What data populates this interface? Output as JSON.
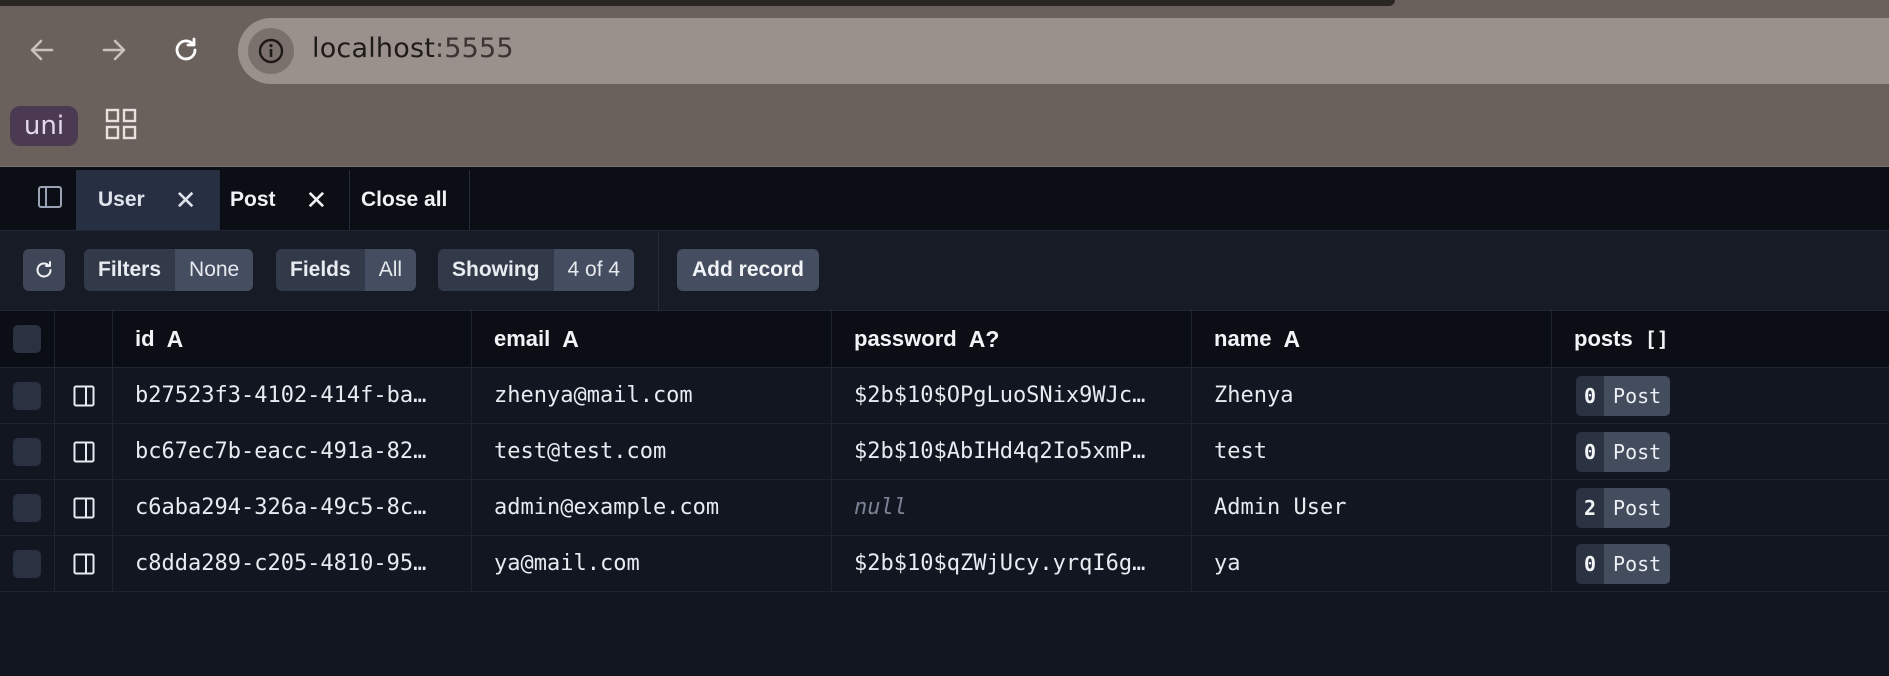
{
  "browser": {
    "url_host": "localhost",
    "url_port": ":5555",
    "extension_label": "uni"
  },
  "tabs": [
    {
      "label": "User",
      "active": true
    },
    {
      "label": "Post",
      "active": false
    }
  ],
  "close_all_label": "Close all",
  "toolbar": {
    "filters": {
      "key": "Filters",
      "value": "None"
    },
    "fields": {
      "key": "Fields",
      "value": "All"
    },
    "showing": {
      "key": "Showing",
      "value": "4 of 4"
    },
    "add_record": "Add record"
  },
  "columns": [
    {
      "name": "id",
      "type": "A"
    },
    {
      "name": "email",
      "type": "A"
    },
    {
      "name": "password",
      "type": "A?"
    },
    {
      "name": "name",
      "type": "A"
    },
    {
      "name": "posts",
      "type": "[]"
    }
  ],
  "rows": [
    {
      "id": "b27523f3-4102-414f-ba…",
      "email": "zhenya@mail.com",
      "password": "$2b$10$OPgLuoSNix9WJc…",
      "name": "Zhenya",
      "posts_count": "0",
      "posts_label": "Post"
    },
    {
      "id": "bc67ec7b-eacc-491a-82…",
      "email": "test@test.com",
      "password": "$2b$10$AbIHd4q2Io5xmP…",
      "name": "test",
      "posts_count": "0",
      "posts_label": "Post"
    },
    {
      "id": "c6aba294-326a-49c5-8c…",
      "email": "admin@example.com",
      "password": "null",
      "name": "Admin User",
      "posts_count": "2",
      "posts_label": "Post"
    },
    {
      "id": "c8dda289-c205-4810-95…",
      "email": "ya@mail.com",
      "password": "$2b$10$qZWjUcy.yrqI6g…",
      "name": "ya",
      "posts_count": "0",
      "posts_label": "Post"
    }
  ],
  "colors": {
    "chrome_bg": "#6b615c",
    "app_bg": "#111620",
    "header_bg": "#0b0e14",
    "active_tab": "#273043",
    "button_bg": "#454e60"
  }
}
